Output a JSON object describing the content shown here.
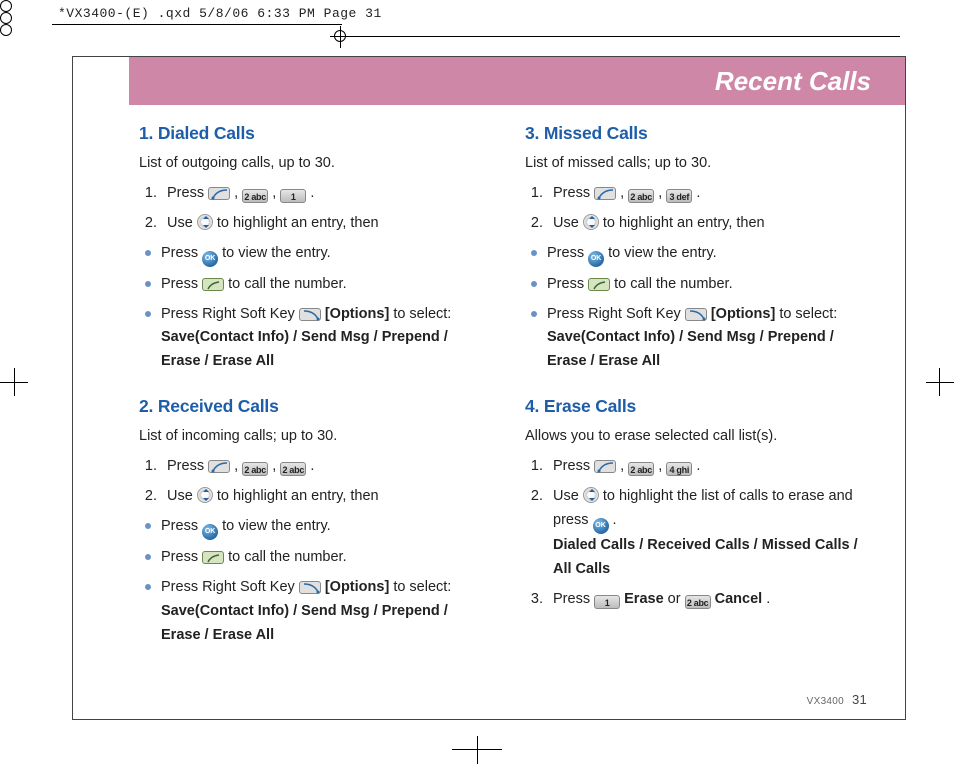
{
  "print_header": "*VX3400-(E) .qxd  5/8/06  6:33 PM  Page 31",
  "header_title": "Recent Calls",
  "footer": {
    "model": "VX3400",
    "page": "31"
  },
  "keys": {
    "soft_left": "left-softkey",
    "two": "2 abc",
    "one": "1",
    "three": "3 def",
    "four": "4 ghi",
    "ok": "OK",
    "nav": "nav-ring",
    "send": "send",
    "soft_right": "right-softkey"
  },
  "dialed": {
    "heading": "1. Dialed Calls",
    "desc": "List of outgoing calls, up to 30.",
    "step1_a": "Press ",
    "step1_b": " , ",
    "step1_c": " , ",
    "step1_d": " .",
    "step2_a": "Use ",
    "step2_b": " to highlight an entry, then",
    "b1_a": "Press ",
    "b1_b": " to view the entry.",
    "b2_a": "Press ",
    "b2_b": " to call the number.",
    "b3_a": "Press Right Soft Key ",
    "b3_b": " [Options]",
    "b3_c": " to select:",
    "opts": "Save(Contact Info) / Send Msg / Prepend / Erase / Erase All"
  },
  "received": {
    "heading": "2. Received Calls",
    "desc": "List of incoming calls; up to 30.",
    "step1_a": "Press ",
    "step1_b": " , ",
    "step1_c": " , ",
    "step1_d": " .",
    "step2_a": "Use ",
    "step2_b": " to highlight an entry, then",
    "b1_a": "Press ",
    "b1_b": " to view the entry.",
    "b2_a": "Press ",
    "b2_b": " to call the number.",
    "b3_a": "Press Right Soft Key ",
    "b3_b": " [Options]",
    "b3_c": " to select:",
    "opts": "Save(Contact Info) / Send Msg / Prepend / Erase / Erase All"
  },
  "missed": {
    "heading": "3. Missed Calls",
    "desc": "List of missed calls; up to 30.",
    "step1_a": "Press ",
    "step1_b": " , ",
    "step1_c": " , ",
    "step1_d": " .",
    "step2_a": "Use ",
    "step2_b": " to highlight an entry, then",
    "b1_a": "Press ",
    "b1_b": " to view the entry.",
    "b2_a": "Press ",
    "b2_b": " to call the number.",
    "b3_a": "Press Right Soft Key ",
    "b3_b": " [Options]",
    "b3_c": " to select:",
    "opts": "Save(Contact Info) / Send Msg / Prepend / Erase / Erase All"
  },
  "erase": {
    "heading": "4. Erase Calls",
    "desc": "Allows you to erase selected call list(s).",
    "step1_a": "Press ",
    "step1_b": " , ",
    "step1_c": " , ",
    "step1_d": " .",
    "step2_a": "Use ",
    "step2_b": " to highlight the list of calls to erase and press ",
    "step2_c": " .",
    "lists": "Dialed Calls / Received Calls / Missed Calls / All Calls",
    "step3_a": "Press ",
    "step3_b": " Erase",
    "step3_c": " or  ",
    "step3_d": " Cancel",
    "step3_e": "."
  }
}
